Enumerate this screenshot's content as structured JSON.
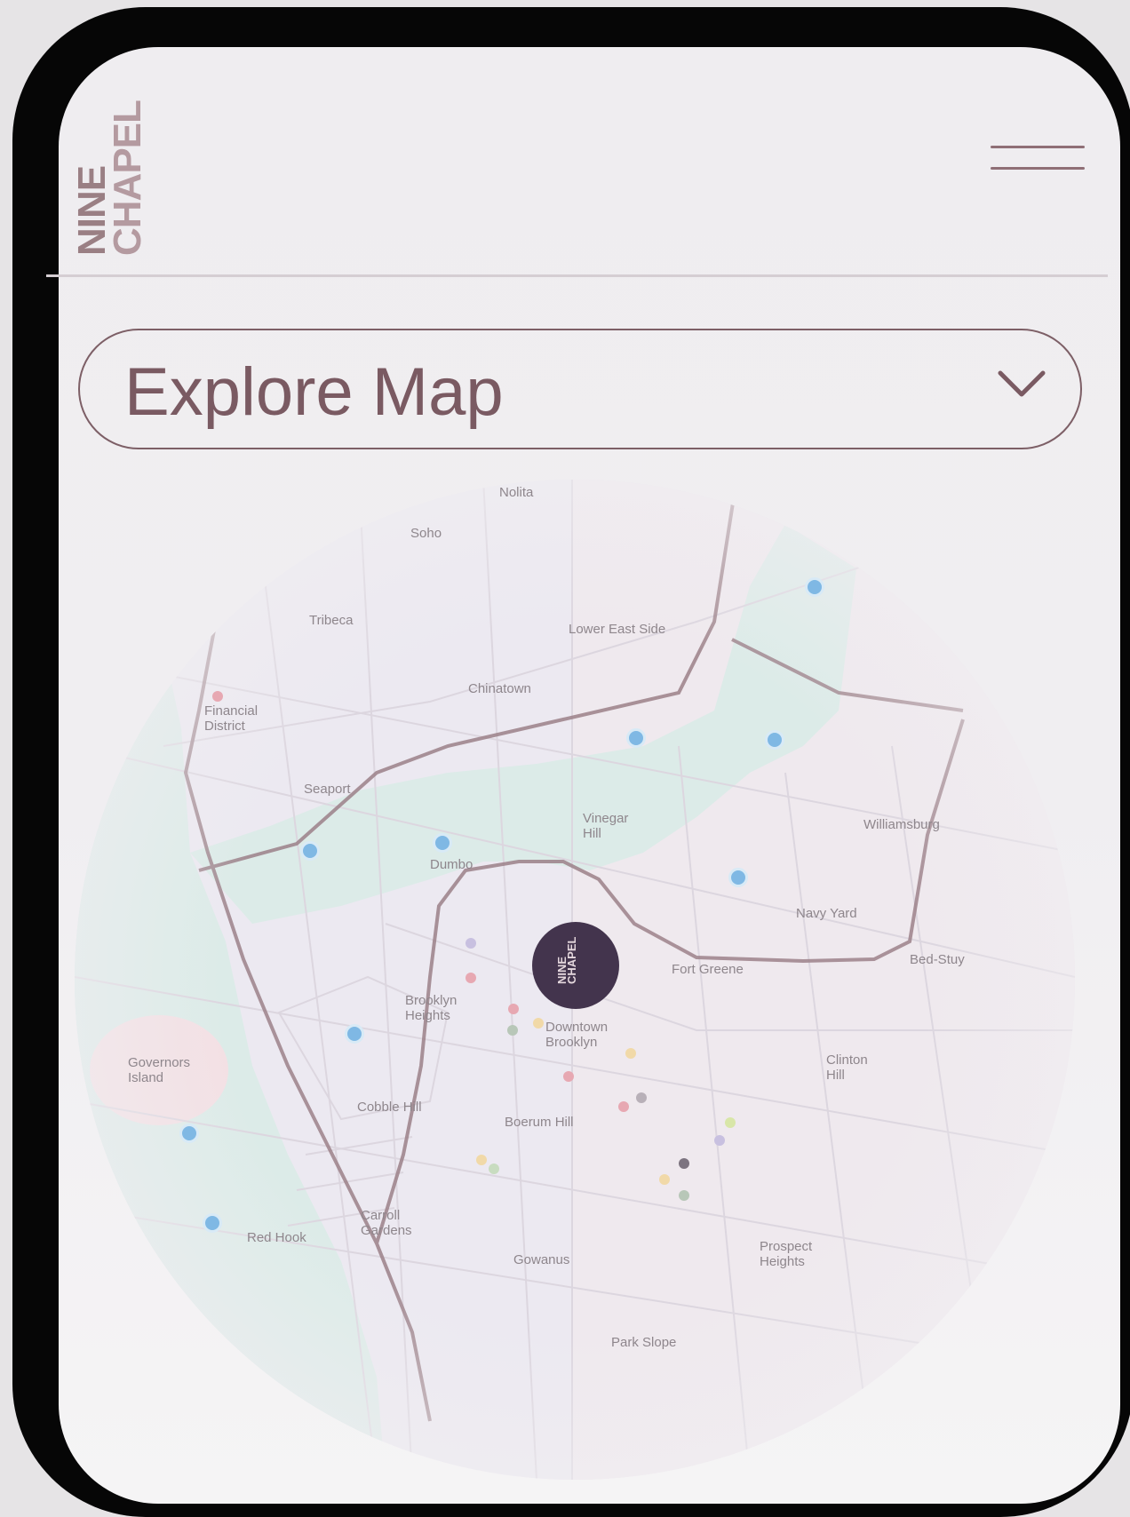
{
  "brand": {
    "line1": "NINE",
    "line2": "CHAPEL"
  },
  "menu": {
    "icon": "hamburger-menu-icon"
  },
  "dropdown": {
    "label": "Explore Map",
    "icon": "chevron-down-icon"
  },
  "map": {
    "neighborhoods": [
      {
        "key": "nolita",
        "name": "Nolita"
      },
      {
        "key": "soho",
        "name": "Soho"
      },
      {
        "key": "tribeca",
        "name": "Tribeca"
      },
      {
        "key": "les",
        "name": "Lower East Side"
      },
      {
        "key": "chinatown",
        "name": "Chinatown"
      },
      {
        "key": "fidi",
        "name": "Financial\nDistrict"
      },
      {
        "key": "seaport",
        "name": "Seaport"
      },
      {
        "key": "vinegar",
        "name": "Vinegar\nHill"
      },
      {
        "key": "williamsburg",
        "name": "Williamsburg"
      },
      {
        "key": "dumbo",
        "name": "Dumbo"
      },
      {
        "key": "navyyard",
        "name": "Navy Yard"
      },
      {
        "key": "fortgreene",
        "name": "Fort Greene"
      },
      {
        "key": "bedstuy",
        "name": "Bed-Stuy"
      },
      {
        "key": "bkheights",
        "name": "Brooklyn\nHeights"
      },
      {
        "key": "downtownbk",
        "name": "Downtown\nBrooklyn"
      },
      {
        "key": "governors",
        "name": "Governors\nIsland"
      },
      {
        "key": "clinton",
        "name": "Clinton\nHill"
      },
      {
        "key": "cobble",
        "name": "Cobble Hill"
      },
      {
        "key": "boerum",
        "name": "Boerum Hill"
      },
      {
        "key": "carroll",
        "name": "Carroll\nGardens"
      },
      {
        "key": "redhook",
        "name": "Red Hook"
      },
      {
        "key": "gowanus",
        "name": "Gowanus"
      },
      {
        "key": "prospect",
        "name": "Prospect\nHeights"
      },
      {
        "key": "parkslope",
        "name": "Park Slope"
      }
    ],
    "location_pin": {
      "line1": "NINE",
      "line2": "CHAPEL"
    },
    "colors": {
      "water": "#dcebe8",
      "road": "#9c8189",
      "poi": "#7fb8e4",
      "pin": "#43344d"
    }
  }
}
